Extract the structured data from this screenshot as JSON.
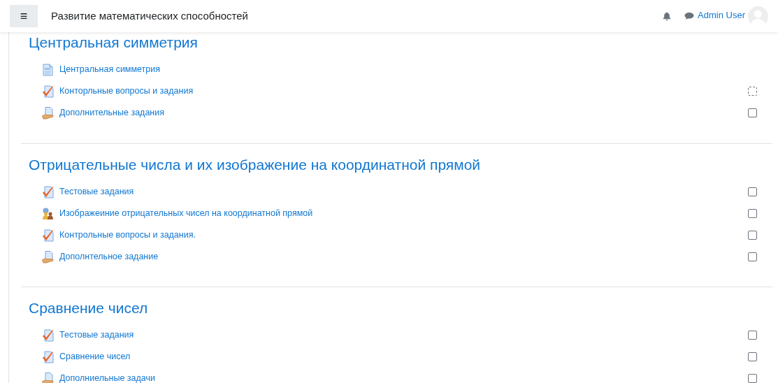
{
  "header": {
    "menu_icon": "≡",
    "course_title": "Развитие математических способностей",
    "user_name": "Admin User"
  },
  "sections": [
    {
      "title": "Центральная симметрия",
      "activities": [
        {
          "kind": "page",
          "name": "Центральная симметрия"
        },
        {
          "kind": "quiz",
          "name": "Конторльные вопросы и задания",
          "completion_box": {
            "kind": "auto"
          }
        },
        {
          "kind": "resource",
          "name": "Дополнительные задания",
          "completion_box": {
            "kind": "manual"
          }
        }
      ]
    },
    {
      "title": "Отрицательные числа и их изображение на координатной прямой",
      "activities": [
        {
          "kind": "quiz",
          "name": "Тестовые задания",
          "completion_box": {
            "kind": "manual"
          }
        },
        {
          "kind": "workshop",
          "name": "Изображеиние отрицательных чисел на координатной прямой",
          "completion_box": {
            "kind": "manual"
          }
        },
        {
          "kind": "quiz",
          "name": "Контрольные вопросы и задания.",
          "completion_box": {
            "kind": "manual"
          }
        },
        {
          "kind": "resource",
          "name": "Дополнтельное задание",
          "completion_box": {
            "kind": "manual"
          }
        }
      ]
    },
    {
      "title": "Сравнение чисел",
      "activities": [
        {
          "kind": "quiz",
          "name": "Тестовые задания",
          "completion_box": {
            "kind": "manual"
          }
        },
        {
          "kind": "quiz",
          "name": "Сравнение чисел",
          "completion_box": {
            "kind": "manual"
          }
        },
        {
          "kind": "resource",
          "name": "Дополниельные задачи",
          "completion_box": {
            "kind": "manual"
          }
        }
      ]
    }
  ]
}
